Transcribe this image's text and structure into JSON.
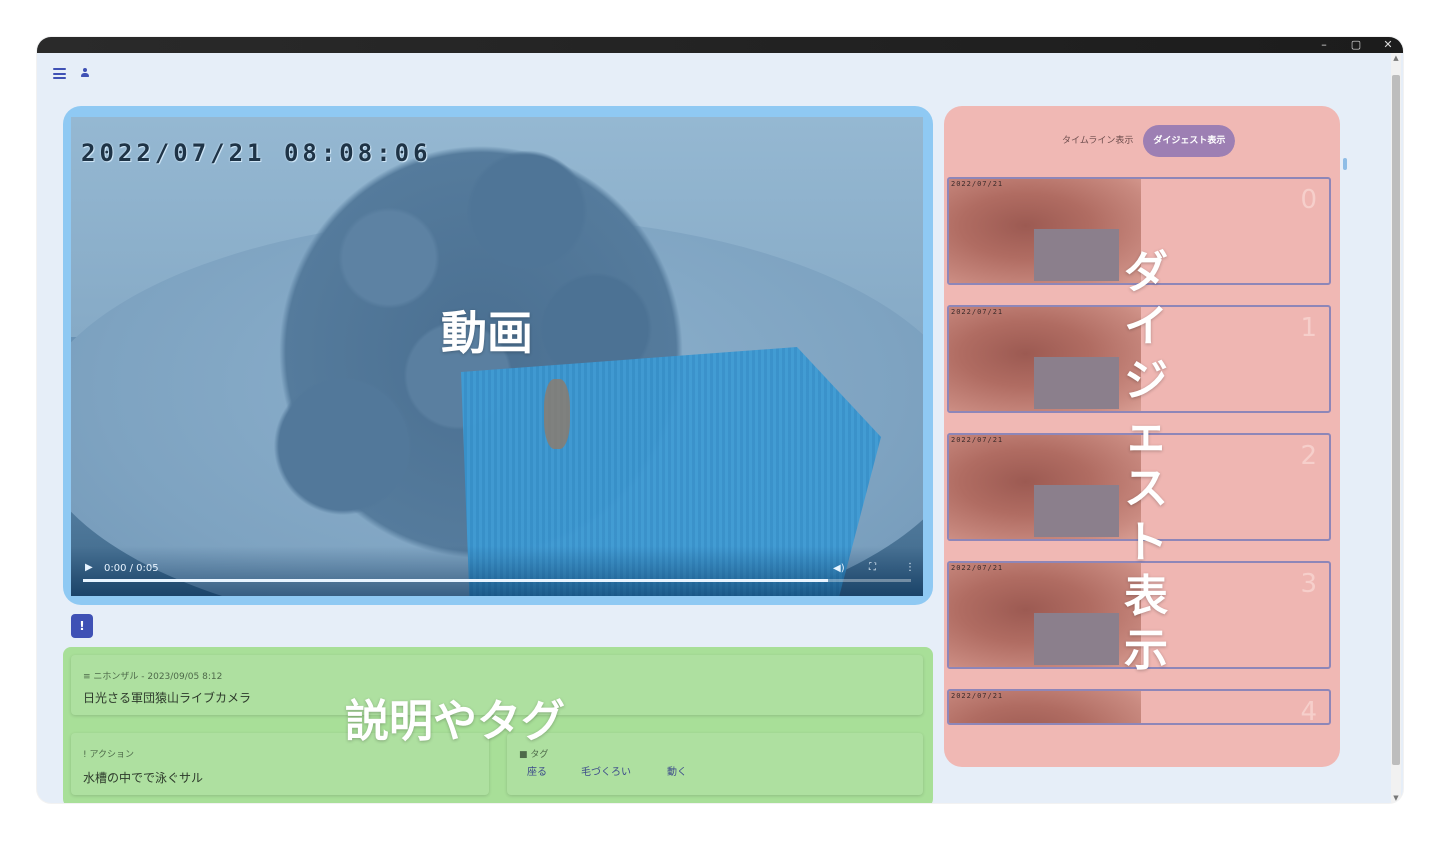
{
  "window": {
    "controls": [
      "–",
      "▢",
      "✕"
    ]
  },
  "video": {
    "timestamp": "2022/07/21  08:08:06",
    "overlay_label": "動画",
    "time_display": "0:00 / 0:05",
    "progress": 0.9
  },
  "alert_button": {
    "label": "!"
  },
  "description": {
    "overlay_label": "説明やタグ",
    "title_meta": "ニホンザル - 2023/09/05 8:12",
    "title": "日光さる軍団猿山ライブカメラ",
    "action_meta": "アクション",
    "action": "水槽の中でで泳ぐサル",
    "tags_meta": "タグ",
    "tags": [
      "座る",
      "毛づくろい",
      "動く"
    ]
  },
  "digest": {
    "overlay_label": "ダイジェスト表示",
    "tabs": [
      {
        "label": "タイムライン表示",
        "active": false
      },
      {
        "label": "ダイジェスト表示",
        "active": true
      }
    ],
    "items": [
      {
        "index": "0",
        "thumb_ts": "2022/07/21"
      },
      {
        "index": "1",
        "thumb_ts": "2022/07/21"
      },
      {
        "index": "2",
        "thumb_ts": "2022/07/21"
      },
      {
        "index": "3",
        "thumb_ts": "2022/07/21"
      },
      {
        "index": "4",
        "thumb_ts": "2022/07/21"
      }
    ]
  },
  "colors": {
    "accent": "#3f51b5",
    "video_panel": "#8fc9f3",
    "description_panel": "#a8df98",
    "digest_panel": "#f0b8b4"
  }
}
